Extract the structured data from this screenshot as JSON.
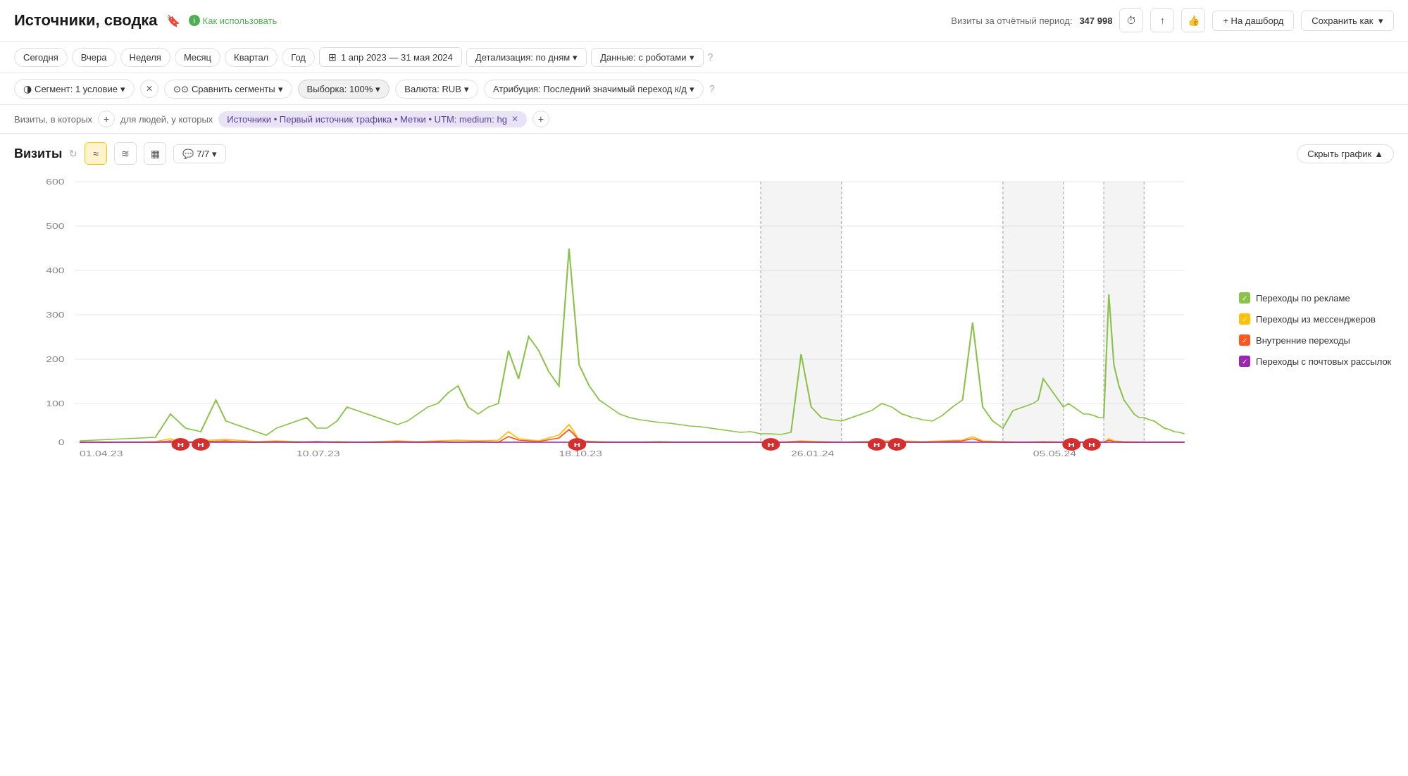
{
  "header": {
    "title": "Источники, сводка",
    "how_to_use": "Как использовать",
    "visits_label": "Визиты за отчётный период:",
    "visits_value": "347 998",
    "btn_dashboard": "+ На дашборд",
    "btn_save": "Сохранить как"
  },
  "date_tabs": {
    "items": [
      "Сегодня",
      "Вчера",
      "Неделя",
      "Месяц",
      "Квартал",
      "Год"
    ]
  },
  "date_range": "1 апр 2023 — 31 мая 2024",
  "detail_label": "Детализация: по дням",
  "data_label": "Данные: с роботами",
  "filters": {
    "segment_label": "Сегмент: 1 условие",
    "compare_label": "Сравнить сегменты",
    "sample_label": "Выборка: 100%",
    "currency_label": "Валюта: RUB",
    "attr_label": "Атрибуция: Последний значимый переход  к/д"
  },
  "segment_bar": {
    "visits_in": "Визиты, в которых",
    "for_people": "для людей, у которых",
    "tag": "Источники • Первый источник трафика • Метки • UTM: medium: hg"
  },
  "chart": {
    "title": "Визиты",
    "comments_label": "7/7",
    "hide_label": "Скрыть график",
    "y_axis": [
      "600",
      "500",
      "400",
      "300",
      "200",
      "100",
      "0"
    ],
    "x_axis": [
      "01.04.23",
      "10.07.23",
      "18.10.23",
      "26.01.24",
      "05.05.24"
    ],
    "legend": [
      {
        "label": "Переходы по рекламе",
        "color": "#8bc34a"
      },
      {
        "label": "Переходы из мессенджеров",
        "color": "#ffc107"
      },
      {
        "label": "Внутренние переходы",
        "color": "#ff5722"
      },
      {
        "label": "Переходы с почтовых рассылок",
        "color": "#9c27b0"
      }
    ]
  }
}
